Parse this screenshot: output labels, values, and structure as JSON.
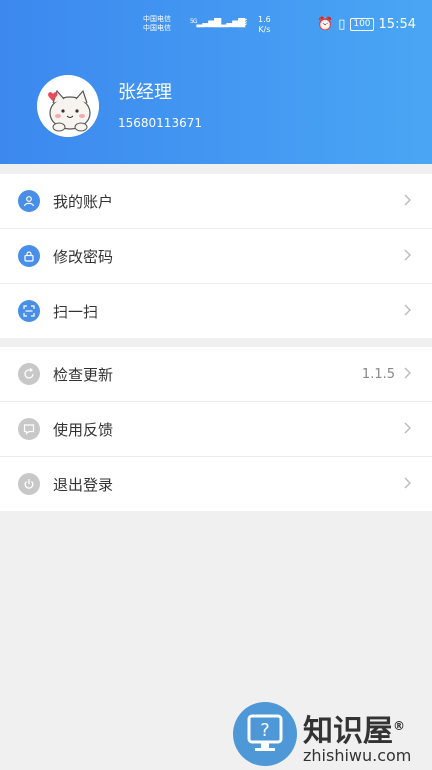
{
  "status_bar": {
    "carrier1": "中国电信",
    "carrier2": "中国电信",
    "net1": "5G",
    "net2": "5G",
    "speed_value": "1.6",
    "speed_unit": "K/s",
    "battery": "100",
    "time": "15:54"
  },
  "profile": {
    "name": "张经理",
    "phone": "15680113671",
    "avatar_icon": "cat-avatar-icon"
  },
  "menu_group_1": [
    {
      "label": "我的账户",
      "icon": "user-icon"
    },
    {
      "label": "修改密码",
      "icon": "lock-icon"
    },
    {
      "label": "扫一扫",
      "icon": "scan-icon"
    }
  ],
  "menu_group_2": [
    {
      "label": "检查更新",
      "icon": "refresh-icon",
      "value": "1.1.5"
    },
    {
      "label": "使用反馈",
      "icon": "feedback-icon"
    },
    {
      "label": "退出登录",
      "icon": "power-icon"
    }
  ],
  "watermark": {
    "cn": "知识屋",
    "registered": "®",
    "en": "zhishiwu.com"
  },
  "colors": {
    "header_start": "#3c88ef",
    "header_end": "#4aa6f4",
    "icon_blue": "#4a8fe7",
    "icon_gray": "#c8c8c8"
  }
}
